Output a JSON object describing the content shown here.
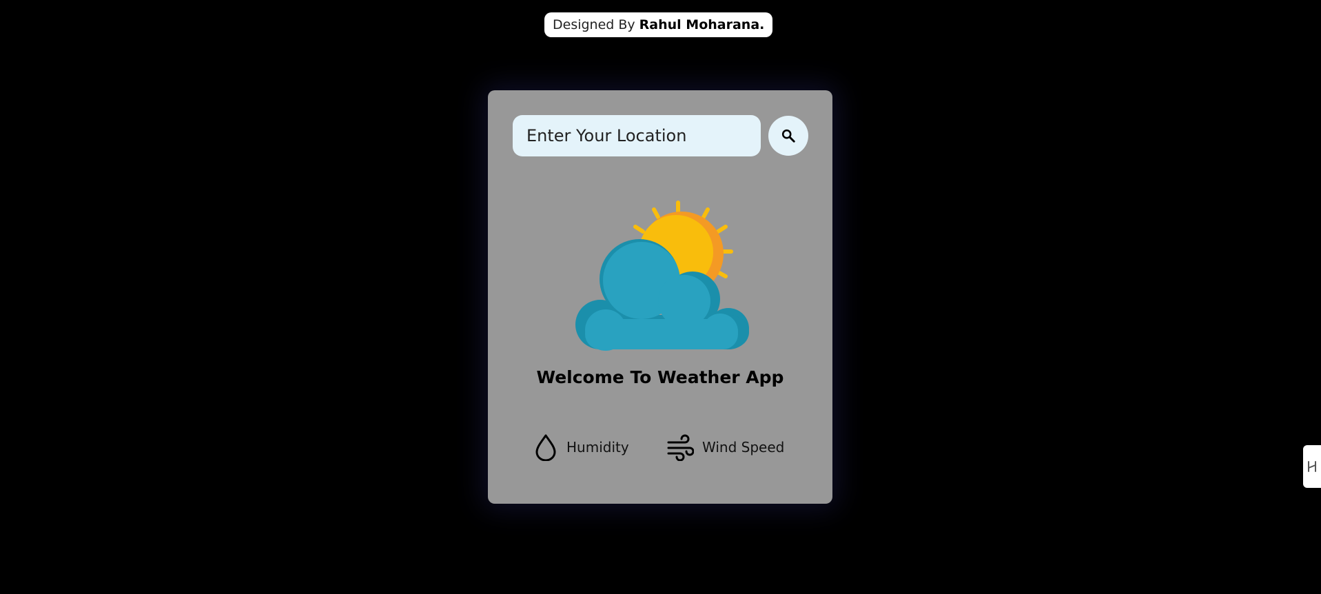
{
  "credit": {
    "prefix": "Designed By",
    "author": "Rahul Moharana."
  },
  "search": {
    "placeholder": "Enter Your Location",
    "value": "",
    "icon": "search-icon"
  },
  "illustration": {
    "icon": "partly-cloudy-icon"
  },
  "welcome": {
    "title": "Welcome To Weather App"
  },
  "stats": {
    "humidity_label": "Humidity",
    "humidity_icon": "water-drop-icon",
    "wind_label": "Wind Speed",
    "wind_icon": "wind-icon"
  },
  "side_tab": {
    "icon": "expand-icon"
  },
  "colors": {
    "background": "#000000",
    "card": "#989898",
    "input_bg": "#e4f3fa",
    "sun": "#f9bd0c",
    "sun_shade": "#f49a24",
    "cloud": "#29a2c0",
    "cloud_shade": "#1b8fab"
  }
}
